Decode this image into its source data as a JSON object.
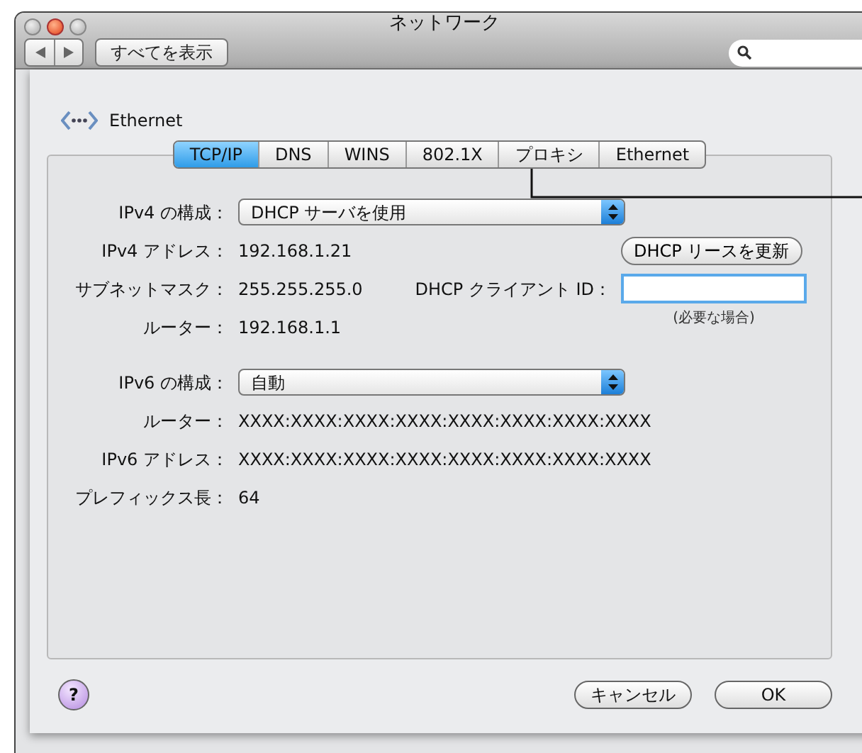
{
  "window": {
    "title": "ネットワーク",
    "show_all_button": "すべてを表示"
  },
  "service": {
    "name": "Ethernet"
  },
  "tabs": [
    {
      "label": "TCP/IP",
      "selected": true
    },
    {
      "label": "DNS",
      "selected": false
    },
    {
      "label": "WINS",
      "selected": false
    },
    {
      "label": "802.1X",
      "selected": false
    },
    {
      "label": "プロキシ",
      "selected": false
    },
    {
      "label": "Ethernet",
      "selected": false
    }
  ],
  "ipv4": {
    "config": {
      "label": "IPv4 の構成：",
      "value": "DHCP サーバを使用"
    },
    "address": {
      "label": "IPv4 アドレス：",
      "value": "192.168.1.21"
    },
    "subnet": {
      "label": "サブネットマスク：",
      "value": "255.255.255.0"
    },
    "router": {
      "label": "ルーター：",
      "value": "192.168.1.1"
    },
    "renew_button": "DHCP リースを更新",
    "client_id": {
      "label": "DHCP クライアント ID：",
      "note": "(必要な場合)"
    }
  },
  "ipv6": {
    "config": {
      "label": "IPv6 の構成：",
      "value": "自動"
    },
    "rows": [
      {
        "label": "ルーター：",
        "value": "XXXX:XXXX:XXXX:XXXX:XXXX:XXXX:XXXX:XXXX"
      },
      {
        "label": "IPv6 アドレス：",
        "value": "XXXX:XXXX:XXXX:XXXX:XXXX:XXXX:XXXX:XXXX"
      },
      {
        "label": "プレフィックス長：",
        "value": "64"
      }
    ]
  },
  "buttons": {
    "help": "?",
    "cancel": "キャンセル",
    "ok": "OK"
  }
}
